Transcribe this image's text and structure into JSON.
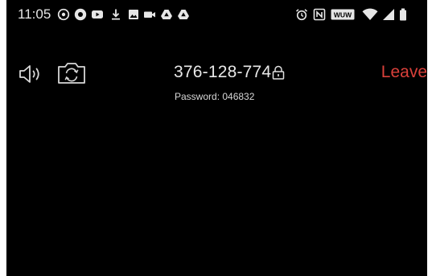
{
  "status_bar": {
    "time": "11:05",
    "left_icons": [
      "whatsapp-icon",
      "record-icon",
      "youtube-icon",
      "download-icon",
      "gallery-icon",
      "video-camera-icon",
      "drive-icon",
      "drive-icon"
    ],
    "right_icons": [
      "alarm-icon",
      "nfc-icon",
      "wuw-badge-icon",
      "wifi-icon",
      "signal-icon",
      "battery-icon"
    ],
    "badge_text": "WUW"
  },
  "meeting": {
    "meeting_id": "376-128-774",
    "password_text": "Password: 046832",
    "leave_label": "Leave",
    "leave_color": "#d9403a"
  }
}
